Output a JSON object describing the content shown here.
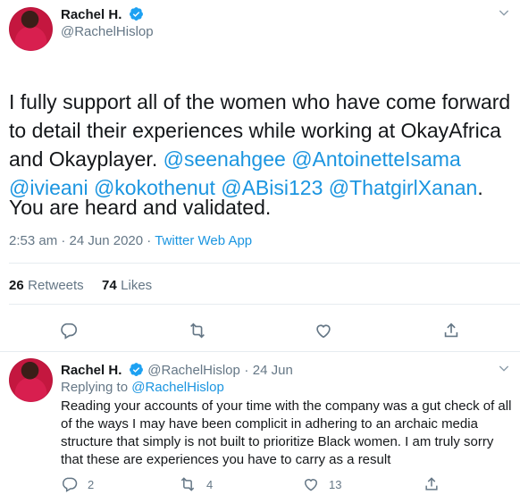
{
  "tweet": {
    "author_name": "Rachel H.",
    "author_handle": "@RachelHislop",
    "text_plain": "I fully support all of the women who have come forward to detail their experiences while working at OkayAfrica and Okayplayer. ",
    "mentions": [
      "@seenahgee",
      "@AntoinetteIsama",
      "@ivieani",
      "@kokothenut",
      "@ABisi123",
      "@ThatgirlXanan"
    ],
    "text_end": ".",
    "text_line2": "You are heard and validated.",
    "time": "2:53 am",
    "sep": " · ",
    "date": "24 Jun 2020",
    "source": "Twitter Web App",
    "retweets_count": "26",
    "retweets_label": "Retweets",
    "likes_count": "74",
    "likes_label": "Likes"
  },
  "reply": {
    "author_name": "Rachel H.",
    "author_handle": "@RachelHislop",
    "dot": "·",
    "date": "24 Jun",
    "replying_prefix": "Replying to ",
    "replying_to": "@RachelHislop",
    "text": "Reading your accounts of your time with the company was a gut check of all of the ways I may have been complicit in adhering to an archaic media structure that simply is not built to prioritize Black women. I am truly sorry that these are experiences you have to carry as a result",
    "reply_count": "2",
    "retweet_count": "4",
    "like_count": "13"
  },
  "icons": {
    "verified": "verified-badge-icon",
    "more": "chevron-down-icon",
    "reply": "reply-icon",
    "retweet": "retweet-icon",
    "like": "heart-icon",
    "share": "share-icon"
  },
  "colors": {
    "link": "#1b95e0",
    "verified": "#1da1f2",
    "secondary_text": "#657786",
    "divider": "#e6ecf0"
  }
}
